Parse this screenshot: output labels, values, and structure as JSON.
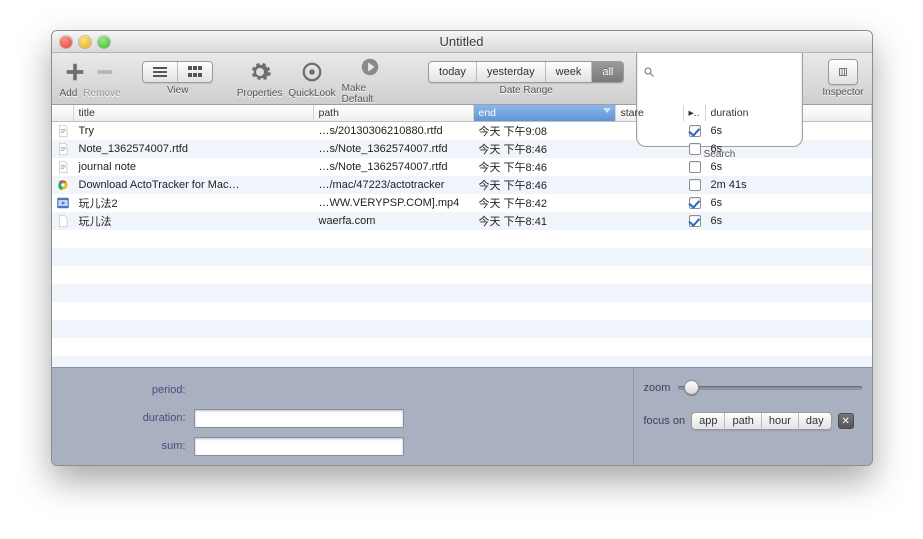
{
  "window": {
    "title": "Untitled"
  },
  "toolbar": {
    "add": "Add",
    "remove": "Remove",
    "view": "View",
    "properties": "Properties",
    "quicklook": "QuickLook",
    "makedefault": "Make Default",
    "daterange": "Date Range",
    "daterange_opts": [
      "today",
      "yesterday",
      "week",
      "all"
    ],
    "daterange_selected": "all",
    "search": "Search",
    "search_placeholder": "",
    "inspector": "Inspector"
  },
  "columns": {
    "title": "title",
    "path": "path",
    "end": "end",
    "stare": "stare",
    "flag": "▸..",
    "duration": "duration",
    "sorted": "end"
  },
  "rows": [
    {
      "icon": "doc",
      "title": "Try",
      "path": "…s/20130306210880.rtfd",
      "end": "今天 下午9:08",
      "checked": true,
      "duration": "6s"
    },
    {
      "icon": "doc",
      "title": "Note_1362574007.rtfd",
      "path": "…s/Note_1362574007.rtfd",
      "end": "今天 下午8:46",
      "checked": false,
      "duration": "6s"
    },
    {
      "icon": "doc",
      "title": "journal note",
      "path": "…s/Note_1362574007.rtfd",
      "end": "今天 下午8:46",
      "checked": false,
      "duration": "6s"
    },
    {
      "icon": "chrome",
      "title": "Download ActoTracker for Mac…",
      "path": "…/mac/47223/actotracker",
      "end": "今天 下午8:46",
      "checked": false,
      "duration": "2m 41s"
    },
    {
      "icon": "video",
      "title": "玩儿法2",
      "path": "…WW.VERYPSP.COM].mp4",
      "end": "今天 下午8:42",
      "checked": true,
      "duration": "6s"
    },
    {
      "icon": "blank",
      "title": "玩儿法",
      "path": "waerfa.com",
      "end": "今天 下午8:41",
      "checked": true,
      "duration": "6s"
    }
  ],
  "bottom": {
    "period": "period:",
    "duration": "duration:",
    "sum": "sum:",
    "zoom": "zoom",
    "focus_on": "focus on",
    "focus_opts": [
      "app",
      "path",
      "hour",
      "day"
    ]
  }
}
